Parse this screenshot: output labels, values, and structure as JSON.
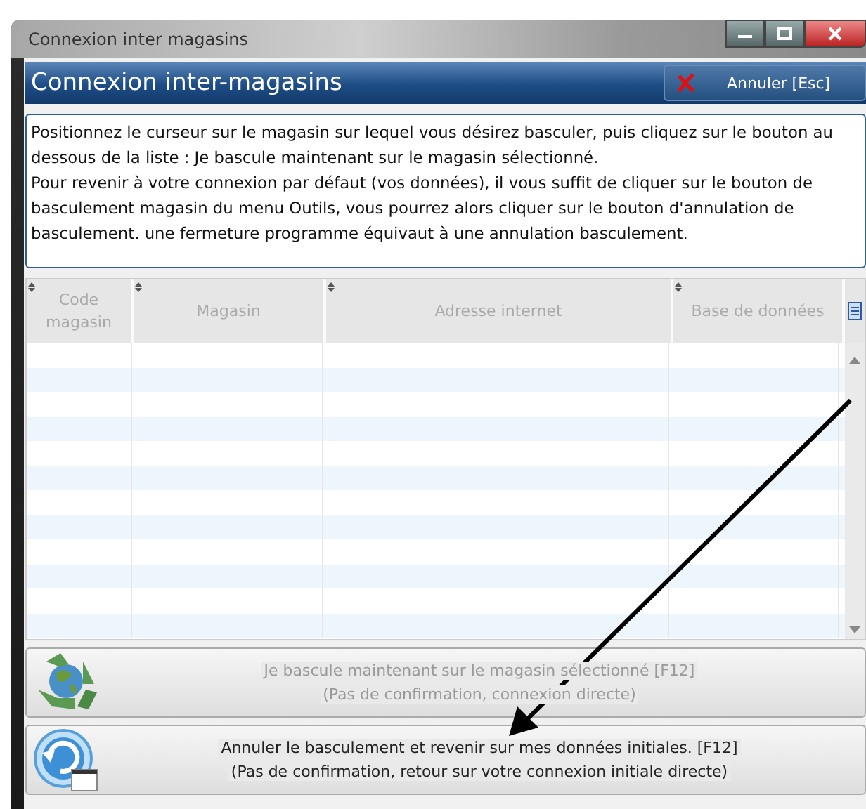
{
  "window": {
    "title": "Connexion inter magasins"
  },
  "header": {
    "title": "Connexion inter-magasins",
    "cancel_button": "Annuler [Esc]"
  },
  "description": [
    "Positionnez le curseur sur le magasin sur lequel vous désirez basculer, puis cliquez sur le bouton au dessous de la liste : Je bascule maintenant sur le magasin sélectionné.",
    "Pour revenir à votre connexion par défaut (vos données), il vous suffit de cliquer sur le bouton de basculement magasin du menu Outils, vous pourrez alors cliquer sur le bouton d'annulation de basculement. une fermeture programme équivaut à une annulation basculement."
  ],
  "table": {
    "columns": [
      {
        "label": "Code magasin"
      },
      {
        "label": "Magasin"
      },
      {
        "label": "Adresse internet"
      },
      {
        "label": "Base de données"
      }
    ]
  },
  "buttons": [
    {
      "kind": "recycle",
      "disabled": true,
      "lines": [
        "Je bascule maintenant sur le magasin sélectionné [F12]",
        "(Pas de confirmation, connexion directe)"
      ]
    },
    {
      "kind": "undo",
      "disabled": false,
      "lines": [
        "Annuler le basculement et revenir sur mes données initiales. [F12]",
        "(Pas de confirmation, retour sur votre connexion initiale directe)"
      ]
    }
  ]
}
